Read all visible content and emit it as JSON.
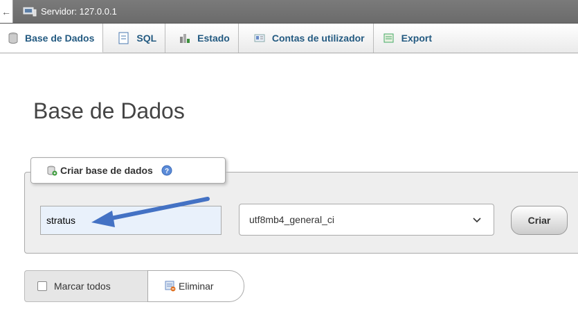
{
  "server": {
    "label": "Servidor: 127.0.0.1",
    "back_icon": "←"
  },
  "tabs": [
    {
      "label": "Base de Dados",
      "icon": "database-icon",
      "active": true
    },
    {
      "label": "SQL",
      "icon": "sql-icon"
    },
    {
      "label": "Estado",
      "icon": "chart-icon"
    },
    {
      "label": "Contas de utilizador",
      "icon": "users-icon"
    },
    {
      "label": "Export",
      "icon": "export-icon"
    }
  ],
  "page": {
    "title": "Base de Dados"
  },
  "create": {
    "legend": "Criar base de dados",
    "db_name_value": "stratus",
    "collation_value": "utf8mb4_general_ci",
    "create_label": "Criar"
  },
  "bottom": {
    "select_all_label": "Marcar todos",
    "delete_label": "Eliminar"
  },
  "colors": {
    "arrow": "#4472c4",
    "link": "#235a81"
  }
}
